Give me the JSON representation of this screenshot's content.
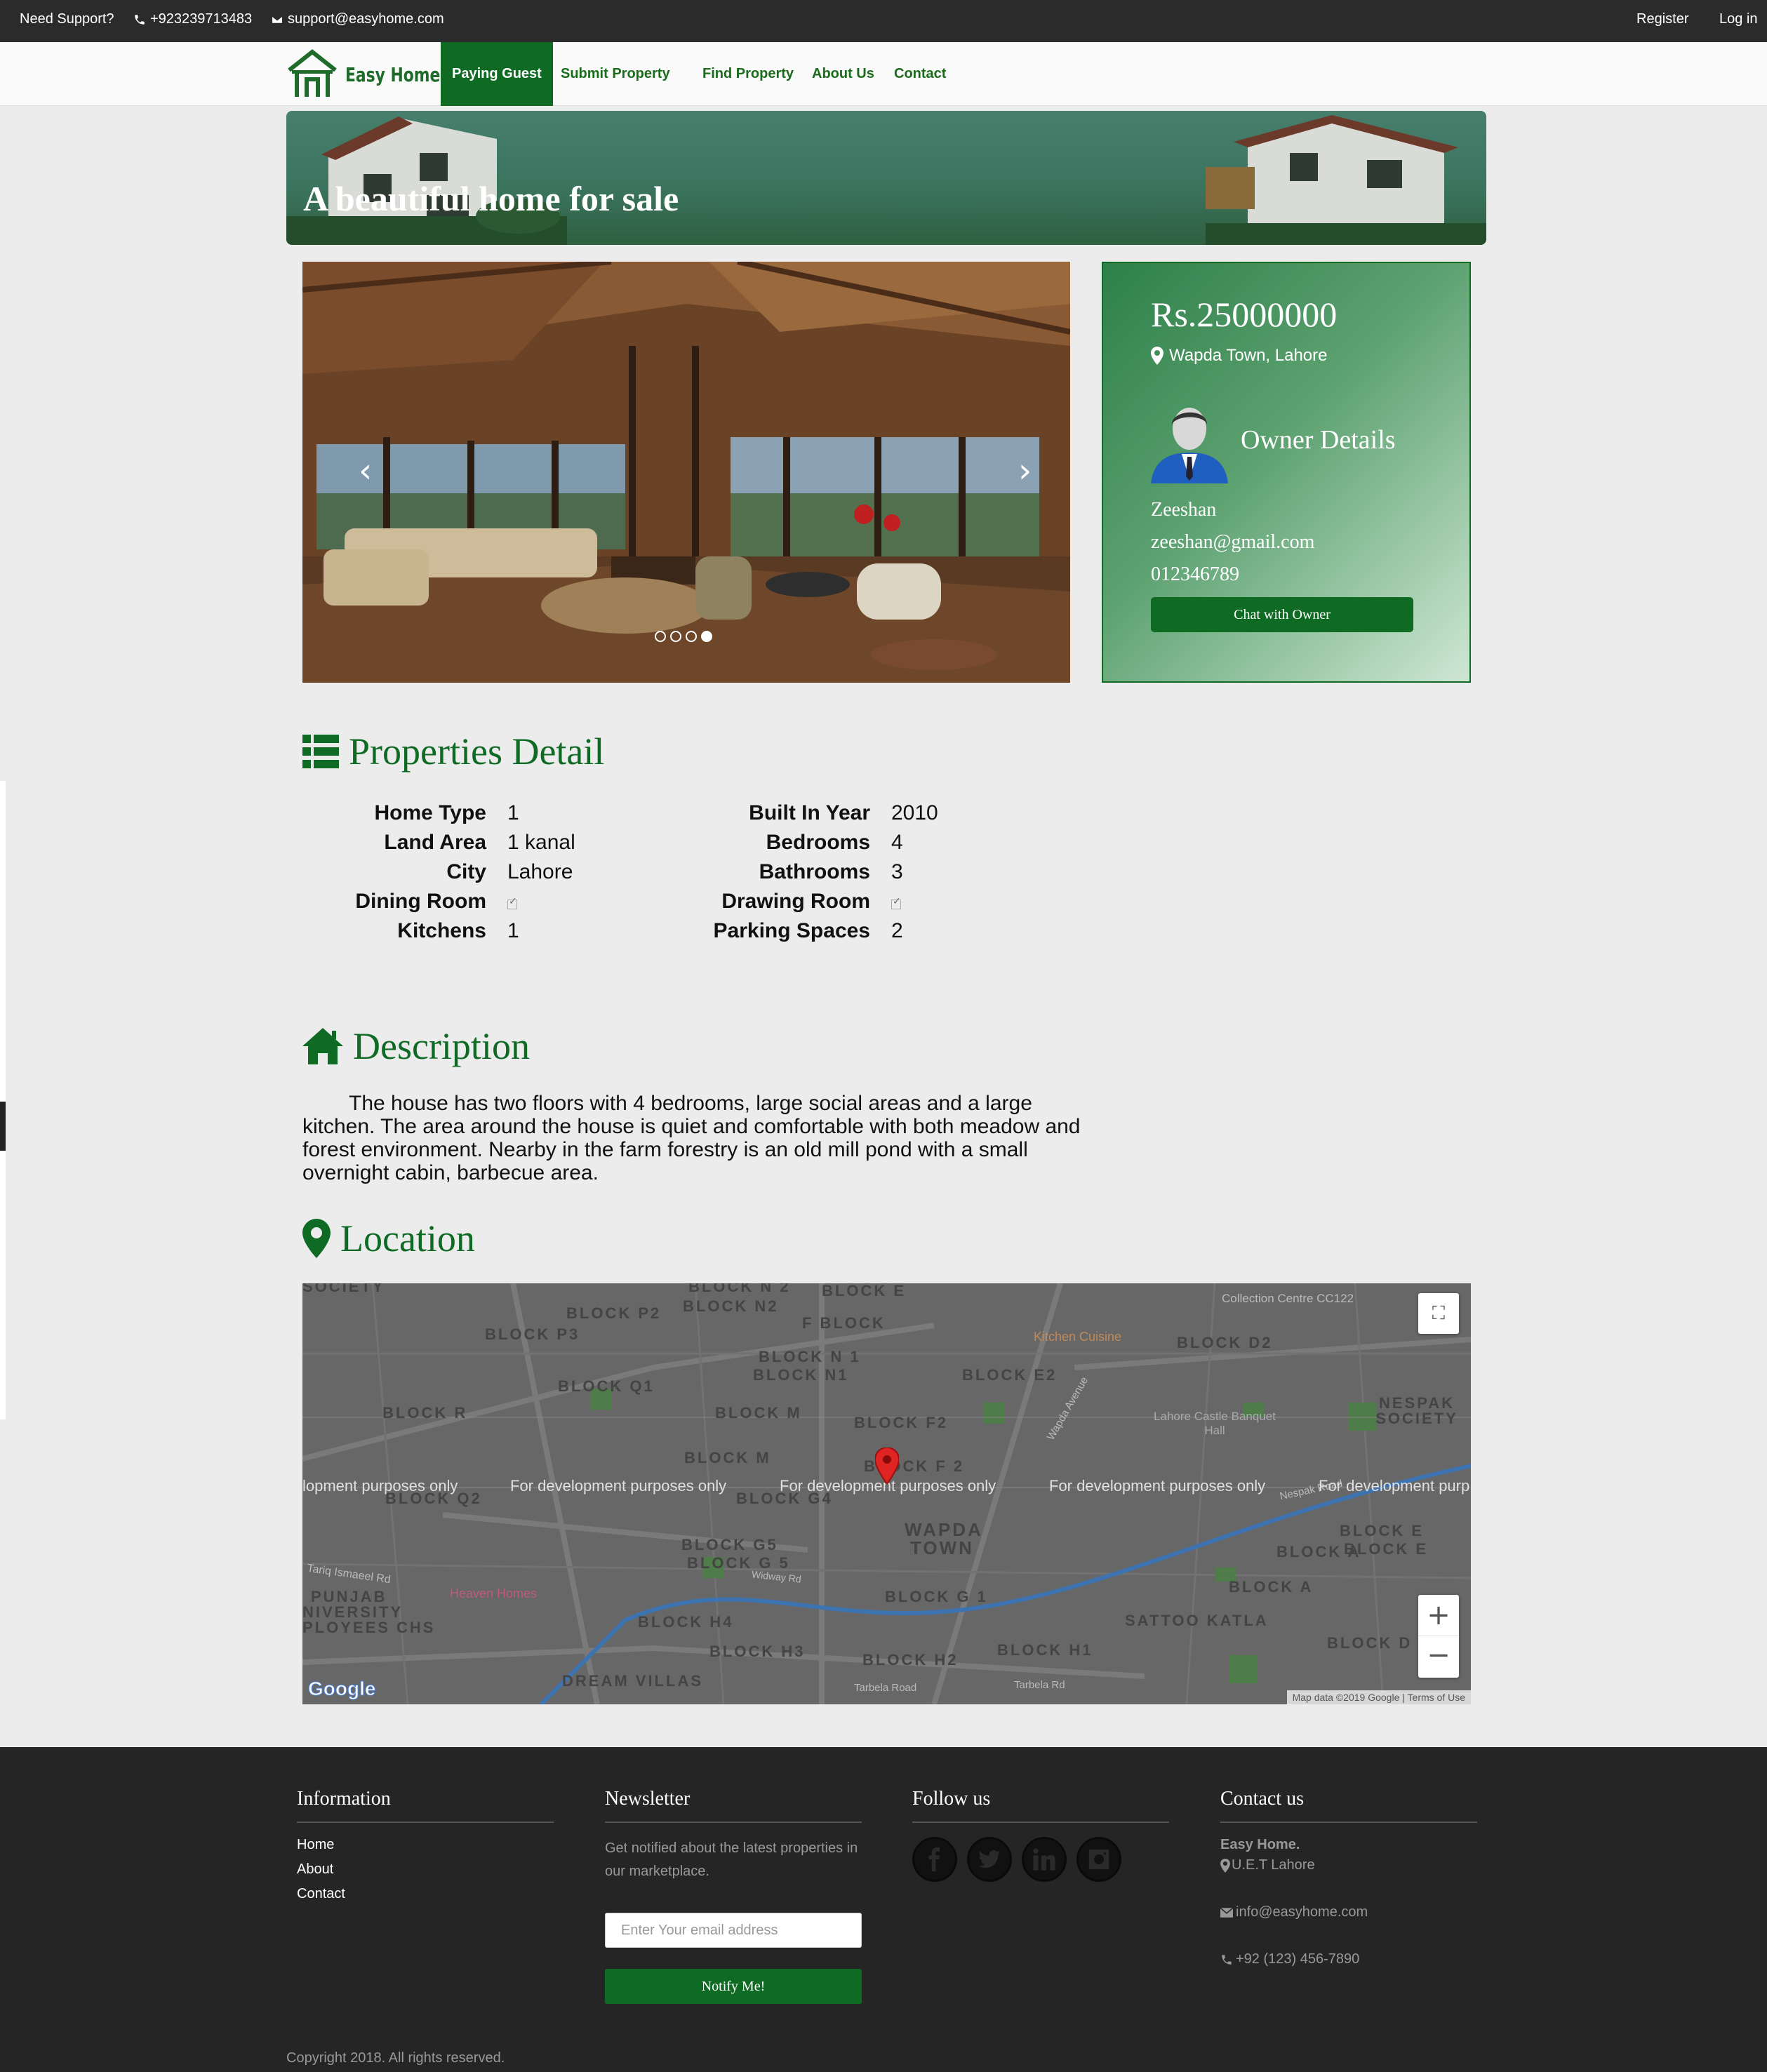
{
  "topbar": {
    "support_label": "Need Support?",
    "phone": "+923239713483",
    "email": "support@easyhome.com",
    "register": "Register",
    "login": "Log in"
  },
  "nav": {
    "brand": "Easy Home",
    "links": [
      "Paying Guest",
      "Submit Property",
      "Find Property",
      "About Us",
      "Contact"
    ],
    "active_index": 0
  },
  "banner": {
    "title": "A beautiful home for sale"
  },
  "carousel": {
    "slide_count": 4,
    "active_slide": 3
  },
  "listing": {
    "price": "Rs.25000000",
    "location": "Wapda Town, Lahore",
    "owner_heading": "Owner Details",
    "owner_name": "Zeeshan",
    "owner_email": "zeeshan@gmail.com",
    "owner_phone": "012346789",
    "chat_button": "Chat with Owner"
  },
  "details": {
    "heading": "Properties Detail",
    "left": [
      {
        "label": "Home Type",
        "value": "1"
      },
      {
        "label": "Land Area",
        "value": "1 kanal"
      },
      {
        "label": "City",
        "value": "Lahore"
      },
      {
        "label": "Dining Room",
        "value": "",
        "checkbox": true
      },
      {
        "label": "Kitchens",
        "value": "1"
      }
    ],
    "right": [
      {
        "label": "Built In Year",
        "value": "2010"
      },
      {
        "label": "Bedrooms",
        "value": "4"
      },
      {
        "label": "Bathrooms",
        "value": "3"
      },
      {
        "label": "Drawing Room",
        "value": "",
        "checkbox": true
      },
      {
        "label": "Parking Spaces",
        "value": "2"
      }
    ]
  },
  "description": {
    "heading": "Description",
    "text": "The house has two floors with 4 bedrooms, large social areas and a large kitchen. The area around the house is quiet and comfortable with both meadow and forest environment. Nearby in the farm forestry is an old mill pond with a small overnight cabin, barbecue area."
  },
  "location": {
    "heading": "Location",
    "map": {
      "dev_notice": "For development purposes only",
      "dev_notice_left": "lopment purposes only",
      "dev_notice_right": "For development purp",
      "attribution": "Map data ©2019 Google",
      "terms": "Terms of Use",
      "google": "Google",
      "labels": [
        "SOCIETY",
        "BLOCK N 2",
        "BLOCK E",
        "BLOCK P2",
        "BLOCK N2",
        "F BLOCK",
        "BLOCK P3",
        "BLOCK D2",
        "BLOCK N 1",
        "BLOCK N1",
        "BLOCK E2",
        "BLOCK Q1",
        "BLOCK R",
        "BLOCK M",
        "BLOCK F2",
        "NESPAK SOCIETY",
        "BLOCK M",
        "BLOCK F 2",
        "BLOCK Q2",
        "BLOCK G4",
        "WAPDA",
        "TOWN",
        "BLOCK G5",
        "BLOCK G 5",
        "BLOCK G 1",
        "BLOCK E",
        "BLOCK E",
        "BLOCK A",
        "BLOCK A",
        "PUNJAB",
        "NIVERSITY",
        "PLOYEES CHS",
        "BLOCK H4",
        "BLOCK H3",
        "BLOCK H2",
        "BLOCK H1",
        "SATTOO KATLA",
        "BLOCK D",
        "DREAM VILLAS"
      ],
      "poi": [
        "Kitchen Cuisine",
        "Lahore Castle Banquet Hall",
        "Heaven Homes",
        "Collection Centre CC122"
      ],
      "streets": [
        "Tariq Ismaeel Rd",
        "Widway Rd",
        "Tarbela Road",
        "Tarbela Rd",
        "Nespak Road",
        "Wapda Avenue"
      ]
    }
  },
  "footer": {
    "info_heading": "Information",
    "info_links": [
      "Home",
      "About",
      "Contact"
    ],
    "newsletter_heading": "Newsletter",
    "newsletter_text": "Get notified about the latest properties in our marketplace.",
    "email_placeholder": "Enter Your email address",
    "notify_button": "Notify Me!",
    "follow_heading": "Follow us",
    "social": [
      "facebook-icon",
      "twitter-icon",
      "linkedin-icon",
      "instagram-icon"
    ],
    "contact_heading": "Contact us",
    "company": "Easy Home.",
    "address": "U.E.T Lahore",
    "email": "info@easyhome.com",
    "phone": "+92 (123) 456-7890",
    "copyright": "Copyright 2018. All rights reserved."
  },
  "colors": {
    "brand_green": "#0f6b24",
    "topbar": "#2b2b2b",
    "footer": "#252525",
    "page_bg": "#ececec"
  }
}
